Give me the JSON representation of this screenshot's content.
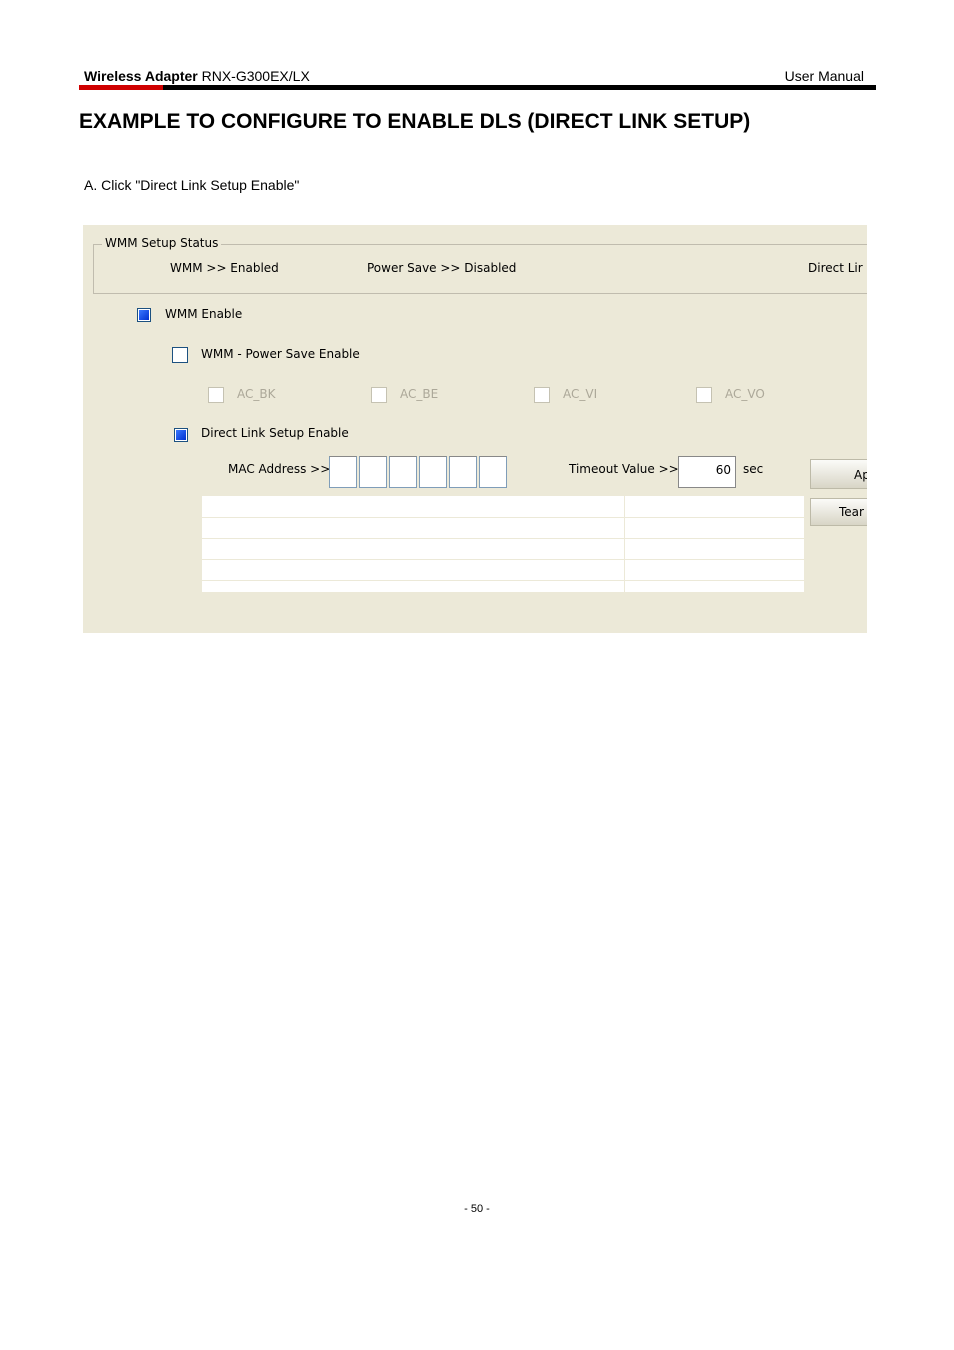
{
  "header": {
    "product_bold": "Wireless Adapter",
    "product_model": "RNX-G300EX/LX",
    "right": "User Manual"
  },
  "title": "EXAMPLE TO CONFIGURE TO ENABLE DLS (DIRECT LINK SETUP)",
  "step": "A. Click \"Direct Link Setup Enable\"",
  "screenshot": {
    "group_title": "WMM Setup Status",
    "wmm_status": "WMM >> Enabled",
    "power_save_status": "Power Save >> Disabled",
    "direct_link_status": "Direct Lir",
    "wmm_enable": {
      "label": "WMM Enable",
      "checked": true
    },
    "wmm_power_save": {
      "label": "WMM - Power Save Enable",
      "checked": false
    },
    "ac": [
      {
        "label": "AC_BK"
      },
      {
        "label": "AC_BE"
      },
      {
        "label": "AC_VI"
      },
      {
        "label": "AC_VO"
      }
    ],
    "dls_enable": {
      "label": "Direct Link Setup Enable",
      "checked": true
    },
    "mac_label": "MAC Address >>",
    "timeout_label": "Timeout Value >>",
    "timeout_value": "60",
    "timeout_unit": "sec",
    "apply_button": "Ap",
    "teardown_button": "Tear"
  },
  "footer": "- 50 -"
}
